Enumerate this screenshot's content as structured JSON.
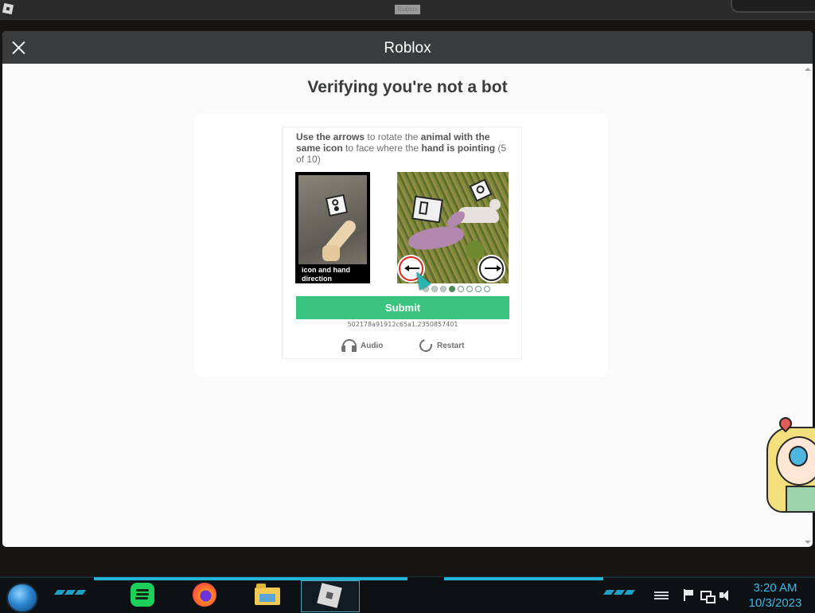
{
  "background_window": {
    "title": "Roblox",
    "app_icon": "roblox-logo-icon"
  },
  "modal": {
    "title": "Roblox",
    "close_icon": "close-icon",
    "heading": "Verifying you're not a bot"
  },
  "captcha": {
    "instruction_parts": [
      {
        "text": "Use the arrows",
        "bold": true
      },
      {
        "text": " to rotate the ",
        "bold": false
      },
      {
        "text": "animal with the same icon",
        "bold": true
      },
      {
        "text": " to face where the ",
        "bold": false
      },
      {
        "text": "hand is pointing",
        "bold": true
      },
      {
        "text": " (5 of 10)",
        "bold": false
      }
    ],
    "reference_caption": "icon and hand direction",
    "reference_icon": "speaker-icon",
    "puzzle_icons": [
      "phone-icon",
      "speaker-icon"
    ],
    "left_arrow_icon": "arrow-left-icon",
    "right_arrow_icon": "arrow-right-icon",
    "progress": {
      "current": 5,
      "total": 10,
      "dots_shown": 8,
      "active_dot": 3
    },
    "submit_label": "Submit",
    "session_id": "502178a91912c65a1.2350857401",
    "audio_label": "Audio",
    "restart_label": "Restart",
    "audio_icon": "headphones-icon",
    "restart_icon": "restart-icon",
    "accent_color": "#3bc47e"
  },
  "taskbar": {
    "start_icon": "start-orb-icon",
    "apps": [
      {
        "name": "Spotify",
        "icon": "spotify-icon"
      },
      {
        "name": "Firefox",
        "icon": "firefox-icon"
      },
      {
        "name": "File Explorer",
        "icon": "folder-icon"
      },
      {
        "name": "Roblox",
        "icon": "roblox-icon",
        "active": true
      }
    ],
    "tray_icons": [
      "menu-icon",
      "flag-icon",
      "network-icon",
      "volume-icon"
    ],
    "time": "3:20 AM",
    "date": "10/3/2023",
    "clock_color": "#3fb8e6"
  }
}
